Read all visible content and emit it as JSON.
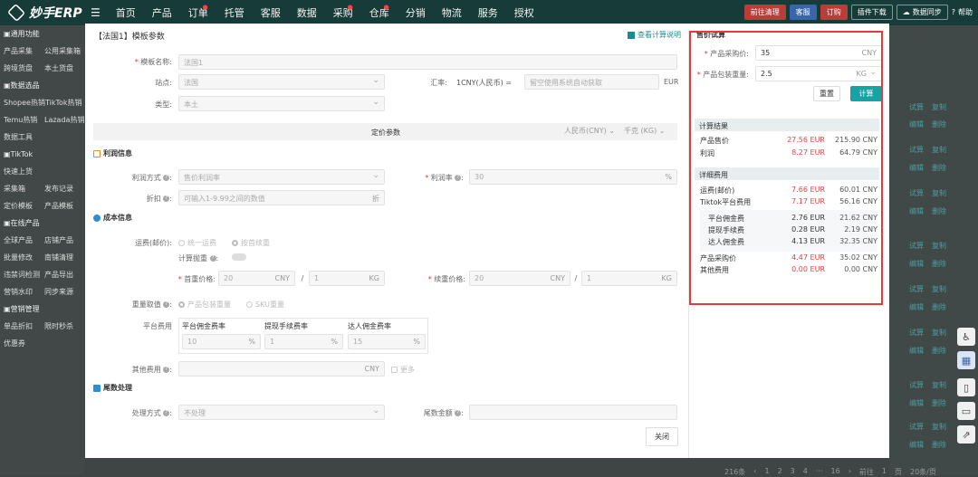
{
  "topbar": {
    "logo": "妙手ERP",
    "nav": [
      "首页",
      "产品",
      "订单",
      "托管",
      "客服",
      "数据",
      "采购",
      "仓库",
      "分销",
      "物流",
      "服务",
      "授权"
    ],
    "nav_dots": [
      false,
      false,
      true,
      false,
      false,
      false,
      true,
      true,
      false,
      false,
      false,
      false
    ],
    "actions": [
      "前往清理",
      "客服",
      "订购",
      "插件下载",
      "数据同步"
    ],
    "help": "帮助"
  },
  "sidebar": [
    {
      "a": "通用功能",
      "b": "",
      "section": true
    },
    {
      "a": "产品采集",
      "b": "公用采集箱"
    },
    {
      "a": "跨境货盘",
      "b": "本土货盘"
    },
    {
      "a": "数据选品",
      "b": "",
      "section": true
    },
    {
      "a": "Shopee热销",
      "b": "TikTok热销"
    },
    {
      "a": "Temu热销",
      "b": "Lazada热销"
    },
    {
      "a": "数据工具",
      "b": ""
    },
    {
      "a": "TikTok",
      "b": "",
      "section": true
    },
    {
      "a": "快速上货",
      "b": ""
    },
    {
      "a": "采集箱",
      "b": "发布记录"
    },
    {
      "a": "定价模板",
      "b": "产品模板"
    },
    {
      "a": "在线产品",
      "b": "",
      "section": true
    },
    {
      "a": "全球产品",
      "b": "店铺产品"
    },
    {
      "a": "批量修改",
      "b": "南铺清理"
    },
    {
      "a": "违禁词检测",
      "b": "产品导出"
    },
    {
      "a": "营销水印",
      "b": "同步来源"
    },
    {
      "a": "营销管理",
      "b": "",
      "section": true
    },
    {
      "a": "单品折扣",
      "b": "限时秒杀"
    },
    {
      "a": "优惠券",
      "b": ""
    }
  ],
  "right_bg": {
    "links": [
      "试算",
      "复制"
    ],
    "links2": [
      "编辑",
      "删除"
    ],
    "pagination": [
      "216条",
      "‹",
      "1",
      "2",
      "3",
      "4",
      "···",
      "16",
      "›",
      "前往",
      "1",
      "页",
      "20条/页"
    ]
  },
  "modal": {
    "title": "【法国1】模板参数",
    "explain_link": "查看计算说明",
    "template_name": {
      "label": "模板名称:",
      "value": "法国1"
    },
    "site": {
      "label": "站点:",
      "value": "法国"
    },
    "rate": {
      "label": "汇率:",
      "prefix": "1CNY(人民币) =",
      "placeholder": "留空使用系统自动获取",
      "unit": "EUR"
    },
    "type": {
      "label": "类型:",
      "value": "本土"
    },
    "param_bar": {
      "title": "定价参数",
      "currency": "人民币(CNY)",
      "weight_unit": "千克 (KG)"
    },
    "profit": {
      "head": "利润信息",
      "method_label": "利润方式",
      "method_value": "售价利润率",
      "rate_label": "利润率",
      "rate_value": "30",
      "rate_unit": "%",
      "discount_label": "折扣",
      "discount_placeholder": "可输入1-9.99之间的数值",
      "discount_unit": "折"
    },
    "cost": {
      "head": "成本信息",
      "shipping_label": "运费(邮价):",
      "option_a": "统一运费",
      "option_b": "按首续重",
      "throw_label": "计算抛重",
      "first_label": "首重价格:",
      "first_price": "20",
      "first_price_unit": "CNY",
      "first_weight": "1",
      "first_weight_unit": "KG",
      "next_label": "续重价格:",
      "next_price": "20",
      "next_price_unit": "CNY",
      "next_weight": "1",
      "next_weight_unit": "KG",
      "weight_pick_label": "重量取值",
      "weight_option_a": "产品包装重量",
      "weight_option_b": "SKU重量",
      "platform_label": "平台费用",
      "platform_cols": [
        {
          "head": "平台佣金费率",
          "value": "10",
          "unit": "%"
        },
        {
          "head": "提现手续费率",
          "value": "1",
          "unit": "%"
        },
        {
          "head": "达人佣金费率",
          "value": "15",
          "unit": "%"
        }
      ],
      "other_label": "其他费用",
      "other_unit": "CNY",
      "more": "更多"
    },
    "tail": {
      "head": "尾数处理",
      "method_label": "处理方式",
      "method_value": "不处理",
      "amount_label": "尾数金额"
    },
    "close_label": "关闭"
  },
  "calc": {
    "title": "售价试算",
    "purchase_label": "产品采购价:",
    "purchase_value": "35",
    "purchase_unit": "CNY",
    "weight_label": "产品包装重量:",
    "weight_value": "2.5",
    "weight_unit": "KG",
    "reset_label": "重置",
    "calc_label": "计算",
    "result_head": "计算结果",
    "results": [
      {
        "name": "产品售价",
        "eur": "27.56 EUR",
        "cny": "215.90 CNY"
      },
      {
        "name": "利润",
        "eur": "8.27 EUR",
        "cny": "64.79 CNY"
      }
    ],
    "detail_head": "详细费用",
    "details": [
      {
        "name": "运费(邮价)",
        "eur": "7.66 EUR",
        "cny": "60.01 CNY",
        "red": true
      },
      {
        "name": "Tiktok平台费用",
        "eur": "7.17 EUR",
        "cny": "56.16 CNY",
        "red": true
      },
      {
        "name": "平台佣金费",
        "eur": "2.76 EUR",
        "cny": "21.62 CNY",
        "red": false
      },
      {
        "name": "提现手续费",
        "eur": "0.28 EUR",
        "cny": "2.19 CNY",
        "red": false
      },
      {
        "name": "达人佣金费",
        "eur": "4.13 EUR",
        "cny": "32.35 CNY",
        "red": false
      },
      {
        "name": "产品采购价",
        "eur": "4.47 EUR",
        "cny": "35.02 CNY",
        "red": true
      },
      {
        "name": "其他费用",
        "eur": "0.00 EUR",
        "cny": "0.00 CNY",
        "red": true
      }
    ]
  }
}
